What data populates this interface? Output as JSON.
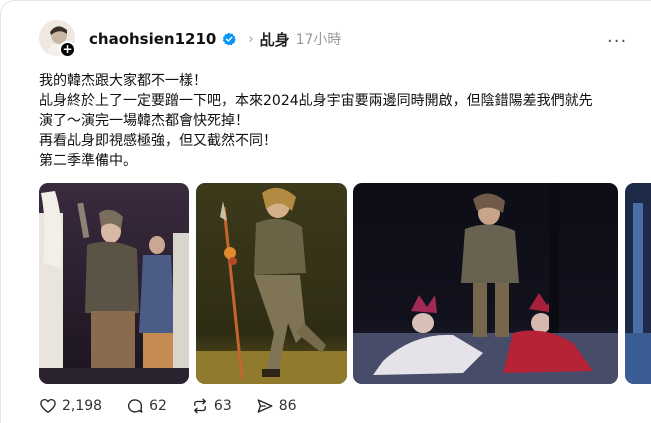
{
  "post": {
    "username": "chaohsien1210",
    "topic": "乩身",
    "time": "17小時",
    "more": "···",
    "lines": [
      "我的韓杰跟大家都不一樣！",
      "乩身終於上了一定要蹭一下吧，本來2024乩身宇宙要兩邊同時開啟，但陰錯陽差我們就先",
      "演了～演完一場韓杰都會快死掉！",
      "再看乩身即視感極強，但又截然不同！",
      "第二季準備中。"
    ],
    "likes": "2,198",
    "replies": "62",
    "reposts": "63",
    "shares": "86"
  },
  "icons": {
    "verified": "verified-badge-icon",
    "like": "heart-icon",
    "reply": "comment-icon",
    "repost": "repost-icon",
    "share": "send-icon",
    "more": "more-dots-icon"
  },
  "colors": {
    "verified": "#0095f6",
    "secondary_text": "#9a9a9a"
  }
}
